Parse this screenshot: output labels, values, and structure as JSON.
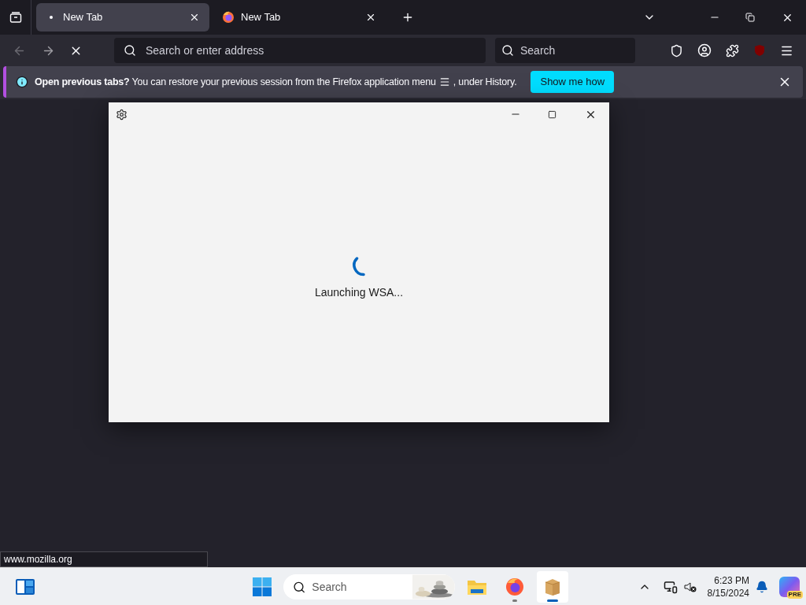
{
  "tabs": [
    {
      "label": "New Tab",
      "selected": true,
      "loading": true
    },
    {
      "label": "New Tab",
      "selected": false,
      "loading": false
    }
  ],
  "toolbar": {
    "back_disabled": true,
    "forward_disabled": false,
    "address_placeholder": "Search or enter address",
    "search_placeholder": "Search"
  },
  "notification": {
    "message": "**Open previous tabs?** You can restore your previous session from the Firefox application menu",
    "message_end": ", under History.",
    "button": "Show me how"
  },
  "dialog": {
    "status": "Launching WSA..."
  },
  "status_url": "www.mozilla.org",
  "taskbar": {
    "search_placeholder": "Search",
    "apps": [
      {
        "kind": "folder",
        "open": false,
        "selected": false
      },
      {
        "kind": "firefox",
        "open": true,
        "selected": false
      },
      {
        "kind": "package",
        "open": true,
        "selected": true
      }
    ],
    "time": "6:23 PM",
    "date": "8/15/2024",
    "copilot_badge": "PRE"
  }
}
